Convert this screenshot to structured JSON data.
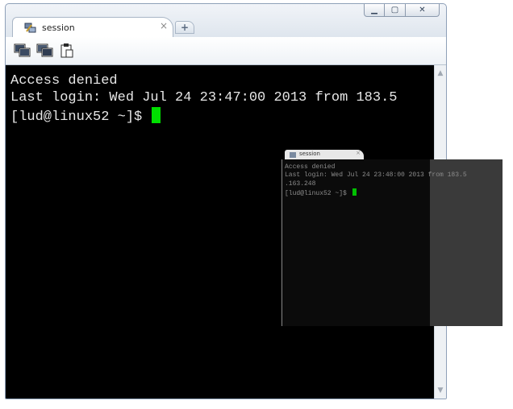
{
  "window": {
    "caption_buttons": {
      "minimize": "▁",
      "maximize": "▢",
      "close": "✕"
    }
  },
  "tab": {
    "label": "session",
    "close": "×",
    "icon": "putty-icon"
  },
  "new_tab": {
    "label": "+"
  },
  "toolbar": {
    "buttons": [
      {
        "icon": "duplicate-session-icon"
      },
      {
        "icon": "new-session-icon"
      },
      {
        "icon": "clipboard-icon"
      }
    ]
  },
  "terminal": {
    "lines": [
      "Access denied",
      "Last login: Wed Jul 24 23:47:00 2013 from 183.5",
      "[lud@linux52 ~]$ "
    ],
    "text_color": "#e6e6e6",
    "cursor_color": "#00e000"
  },
  "ghost_window": {
    "tab_label": "session",
    "tab_close": "×",
    "lines": [
      "Access denied",
      "Last login: Wed Jul 24 23:48:00 2013 from 183.5",
      ".163.248",
      "[lud@linux52 ~]$ "
    ]
  },
  "scrollbar": {
    "up": "▲",
    "down": "▼"
  }
}
